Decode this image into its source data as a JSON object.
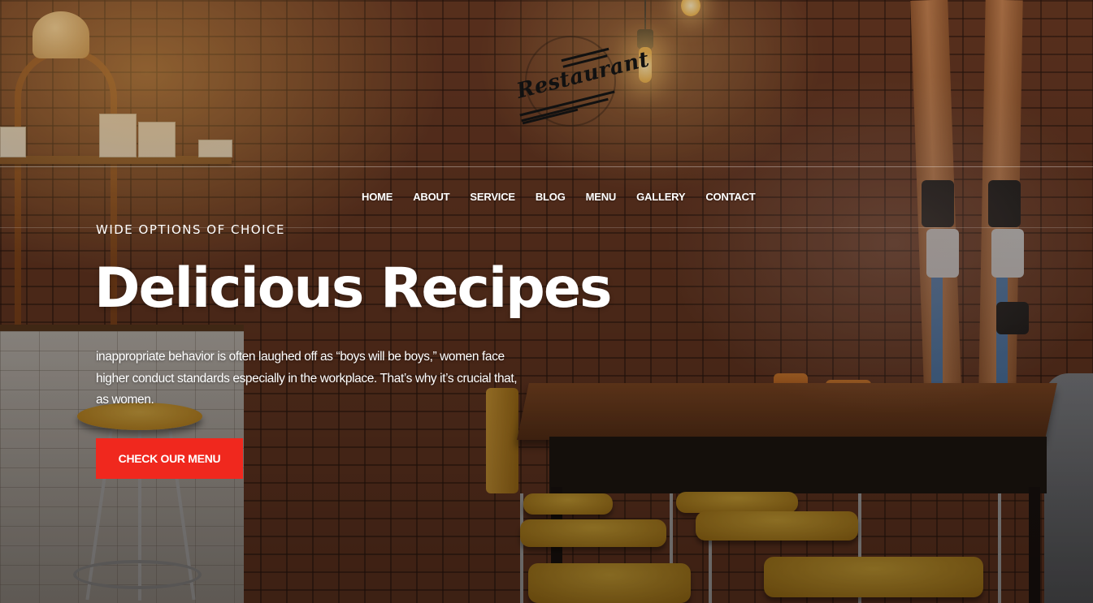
{
  "brand": {
    "logo_text": "Restaurant"
  },
  "nav": {
    "items": [
      {
        "label": "HOME"
      },
      {
        "label": "ABOUT"
      },
      {
        "label": "SERVICE"
      },
      {
        "label": "BLOG"
      },
      {
        "label": "MENU"
      },
      {
        "label": "GALLERY"
      },
      {
        "label": "CONTACT"
      }
    ]
  },
  "hero": {
    "eyebrow": "WIDE OPTIONS OF CHOICE",
    "title": "Delicious Recipes",
    "body": "inappropriate behavior is often laughed off as “boys will be boys,” women face higher conduct standards especially in the workplace. That’s why it’s crucial that, as women.",
    "cta_label": "CHECK OUR MENU",
    "cta_color": "#f0281e"
  },
  "background": {
    "wall_color": "#6b3a24",
    "stool_color": "#efbe3e",
    "chair_color": "#e3842e",
    "ski_stripe_color": "#4f7fb5"
  }
}
